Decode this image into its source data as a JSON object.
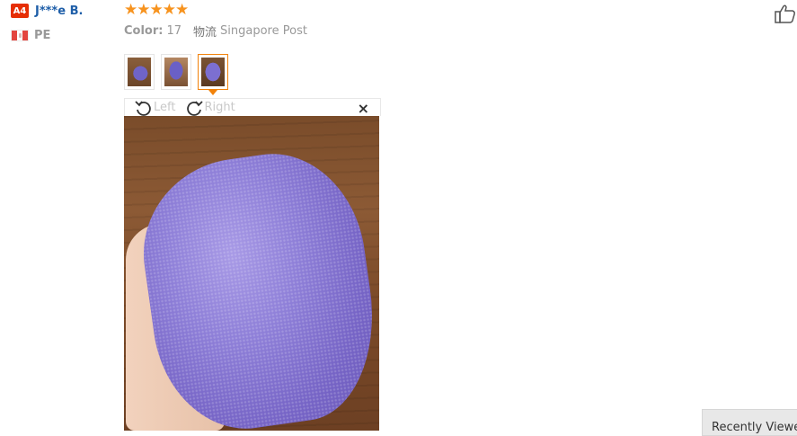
{
  "user": {
    "level_badge": "A4",
    "name": "J***e B.",
    "country_code": "PE",
    "flag_icon": "peru-flag-icon"
  },
  "review": {
    "rating": 5,
    "star_char": "★",
    "color_label": "Color:",
    "color_value": "17",
    "logistics_label": "物流",
    "logistics_value": "Singapore Post",
    "thumbnails_count": 3,
    "active_thumbnail": 3
  },
  "viewer": {
    "rotate_left_label": "Left",
    "rotate_right_label": "Right",
    "close_label": "×"
  },
  "sidebar": {
    "recently_viewed": "Recently Viewed"
  },
  "colors": {
    "star": "#f7931e",
    "username": "#1e5ea8",
    "badge": "#e62e04",
    "active_border": "#f2820a"
  }
}
